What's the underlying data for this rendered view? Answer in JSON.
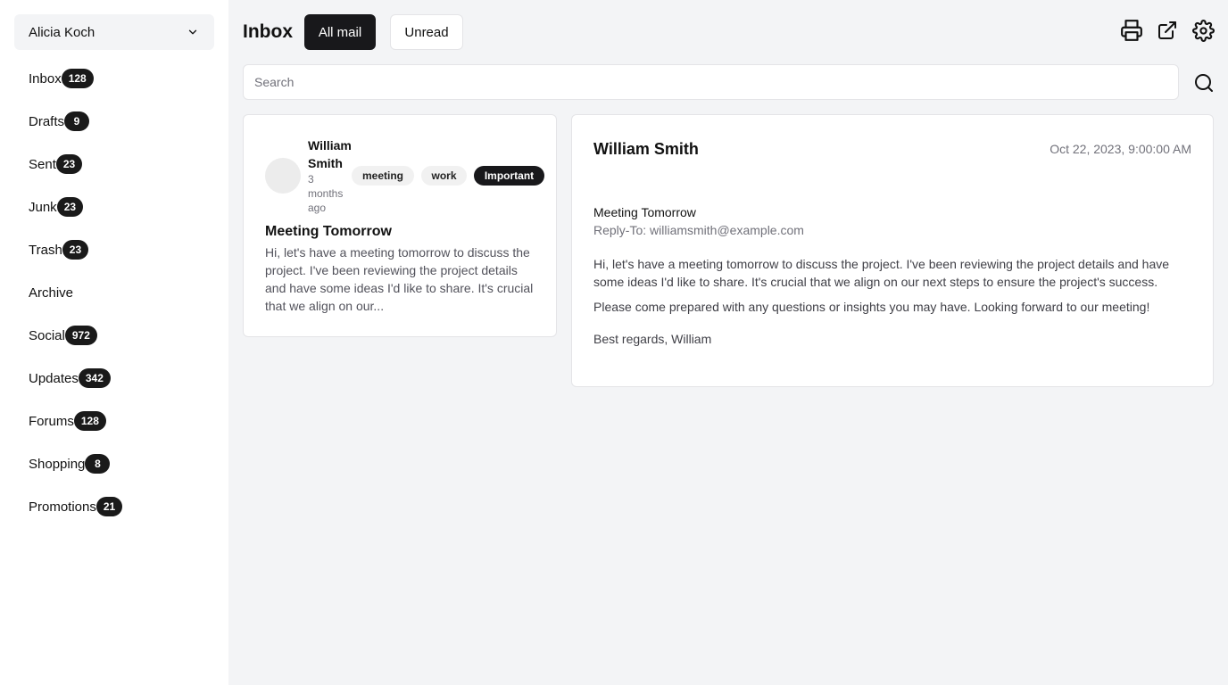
{
  "account": {
    "name": "Alicia Koch"
  },
  "nav": [
    {
      "label": "Inbox",
      "count": "128"
    },
    {
      "label": "Drafts",
      "count": "9"
    },
    {
      "label": "Sent",
      "count": "23"
    },
    {
      "label": "Junk",
      "count": "23"
    },
    {
      "label": "Trash",
      "count": "23"
    },
    {
      "label": "Archive",
      "count": ""
    },
    {
      "label": "Social",
      "count": "972"
    },
    {
      "label": "Updates",
      "count": "342"
    },
    {
      "label": "Forums",
      "count": "128"
    },
    {
      "label": "Shopping",
      "count": "8"
    },
    {
      "label": "Promotions",
      "count": "21"
    }
  ],
  "header": {
    "title": "Inbox",
    "tabs": {
      "all": "All mail",
      "unread": "Unread"
    }
  },
  "search": {
    "placeholder": "Search",
    "value": ""
  },
  "mail": {
    "sender": "William Smith",
    "time_ago": "3 months ago",
    "tags": [
      "meeting",
      "work",
      "important"
    ],
    "subject": "Meeting Tomorrow",
    "preview": "Hi, let's have a meeting tomorrow to discuss the project. I've been reviewing the project details and have some ideas I'd like to share. It's crucial that we align on our..."
  },
  "reader": {
    "from": "William Smith",
    "date": "Oct 22, 2023, 9:00:00 AM",
    "subject": "Meeting Tomorrow",
    "reply_to": "Reply-To: williamsmith@example.com",
    "body": [
      "Hi, let's have a meeting tomorrow to discuss the project. I've been reviewing the project details and have some ideas I'd like to share. It's crucial that we align on our next steps to ensure the project's success.",
      "Please come prepared with any questions or insights you may have. Looking forward to our meeting!",
      "Best regards, William"
    ]
  },
  "icons": {
    "print": "print-icon",
    "open_external": "external-link-icon",
    "settings": "gear-icon",
    "search": "search-icon",
    "account_dropdown": "chevron-down-icon"
  },
  "colors": {
    "accent": "#18181b",
    "background": "#f3f4f6",
    "panel": "#ffffff"
  }
}
